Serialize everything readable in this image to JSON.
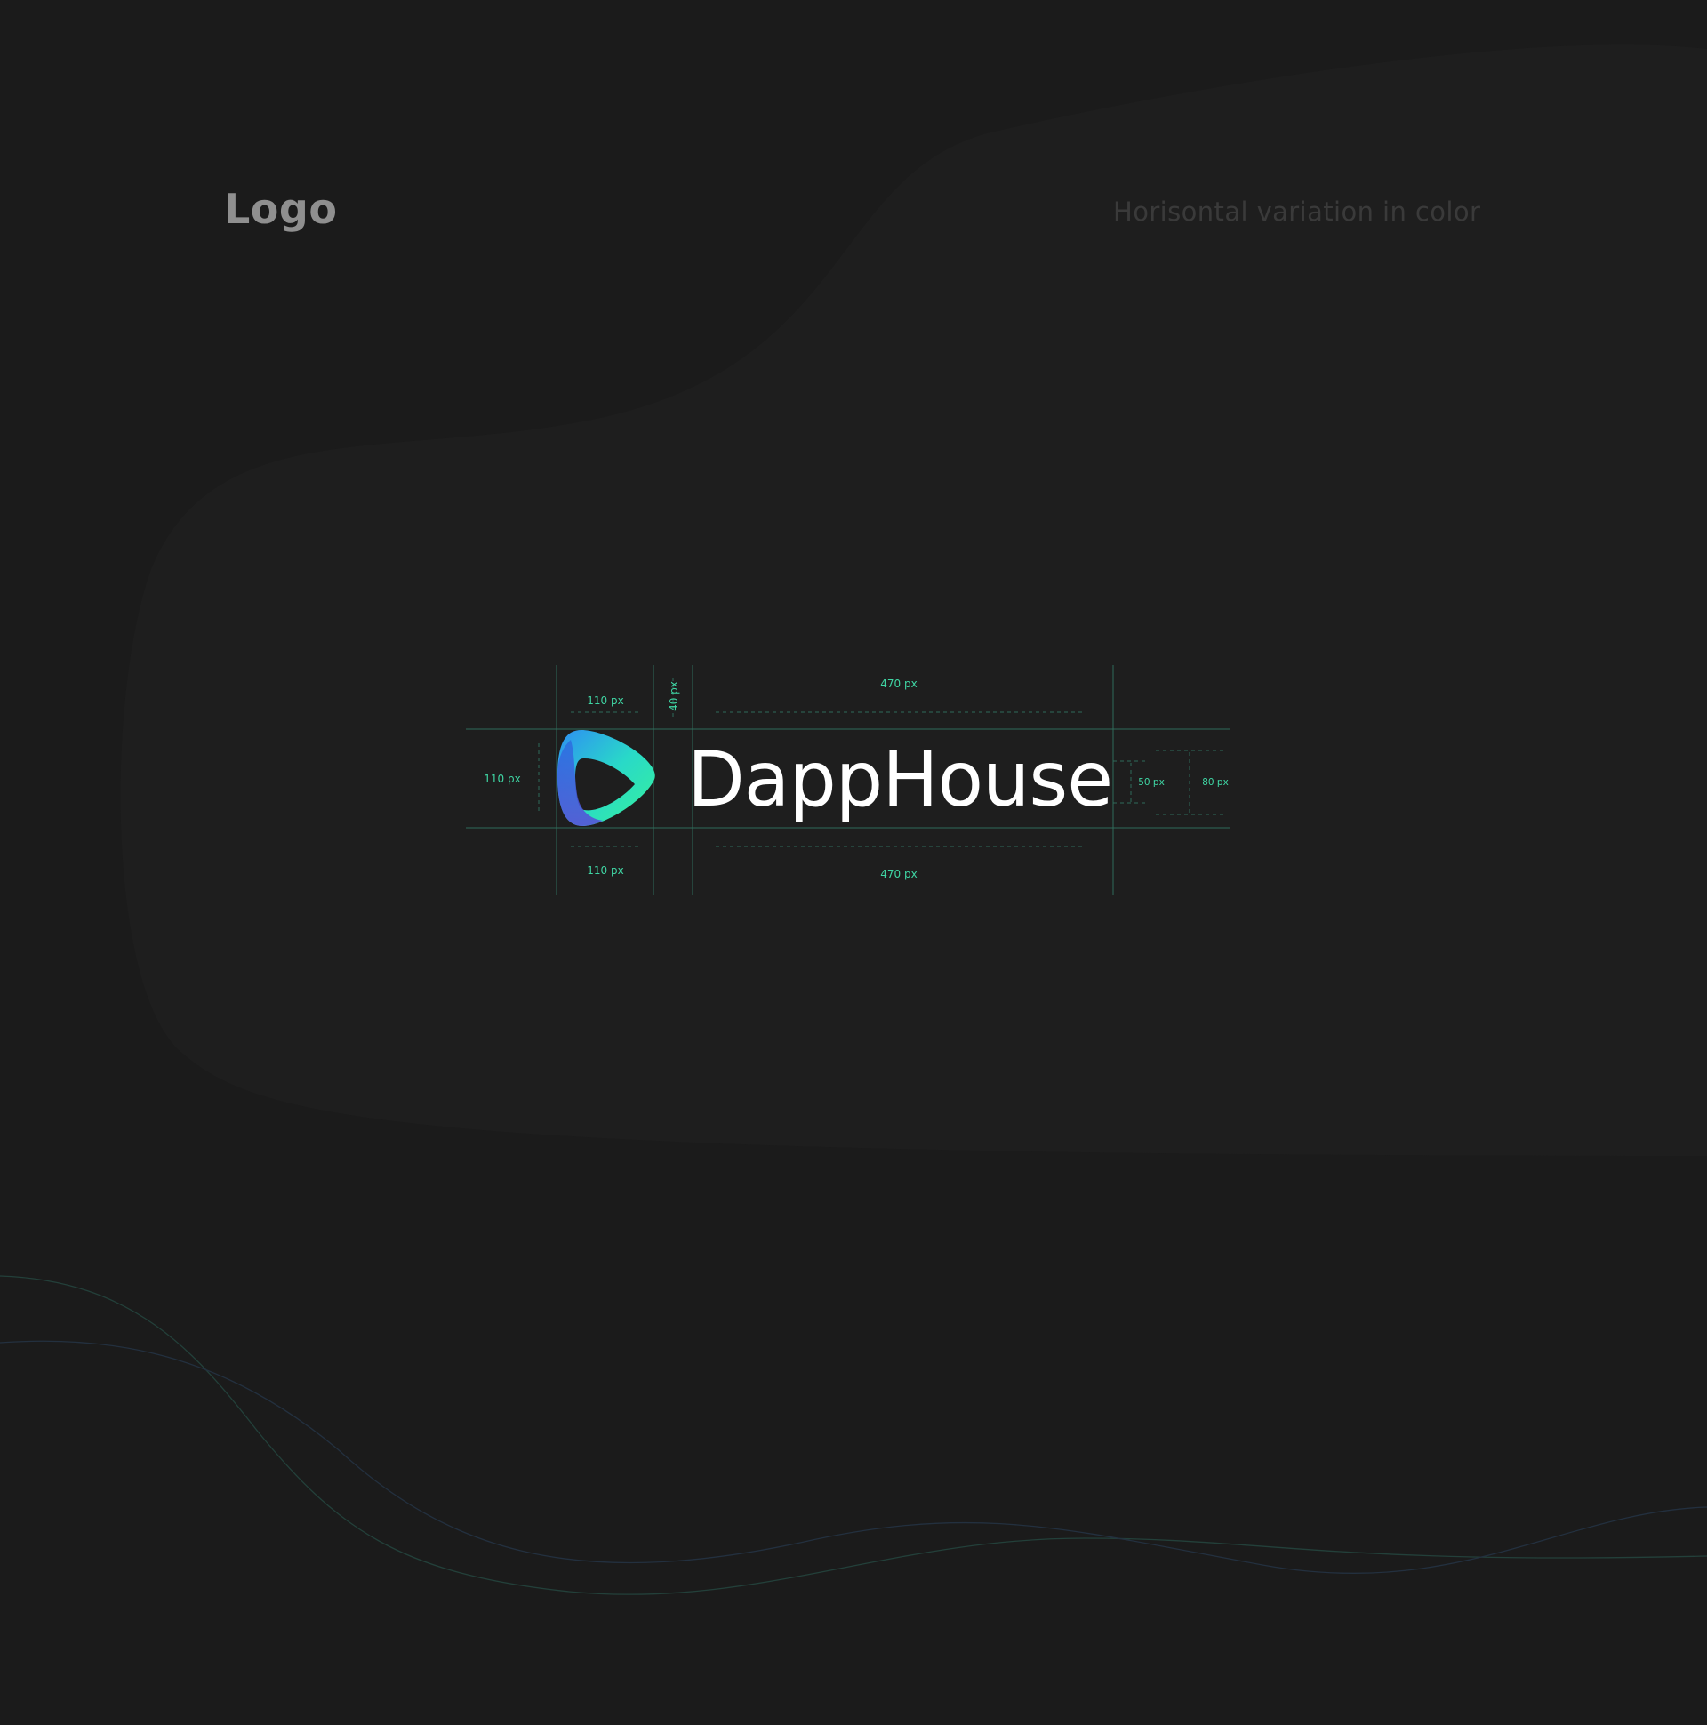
{
  "header": {
    "title": "Logo",
    "subtitle": "Horisontal variation in color"
  },
  "logo": {
    "wordmark": "DappHouse",
    "icon": "play-triangle-icon",
    "gradient_colors": [
      "#2e8df4",
      "#29d9c8",
      "#37f29a"
    ]
  },
  "guides": {
    "icon_width_top": "110 px",
    "icon_width_bottom": "110 px",
    "icon_height": "110 px",
    "gap": "40 px",
    "wordmark_width_top": "470 px",
    "wordmark_width_bottom": "470 px",
    "x_height": "50 px",
    "cap_height": "80 px"
  },
  "colors": {
    "background": "#1b1b1b",
    "guide_line": "#2f6b5a",
    "guide_text": "#3fd6a4",
    "title": "#8f8f8f"
  }
}
